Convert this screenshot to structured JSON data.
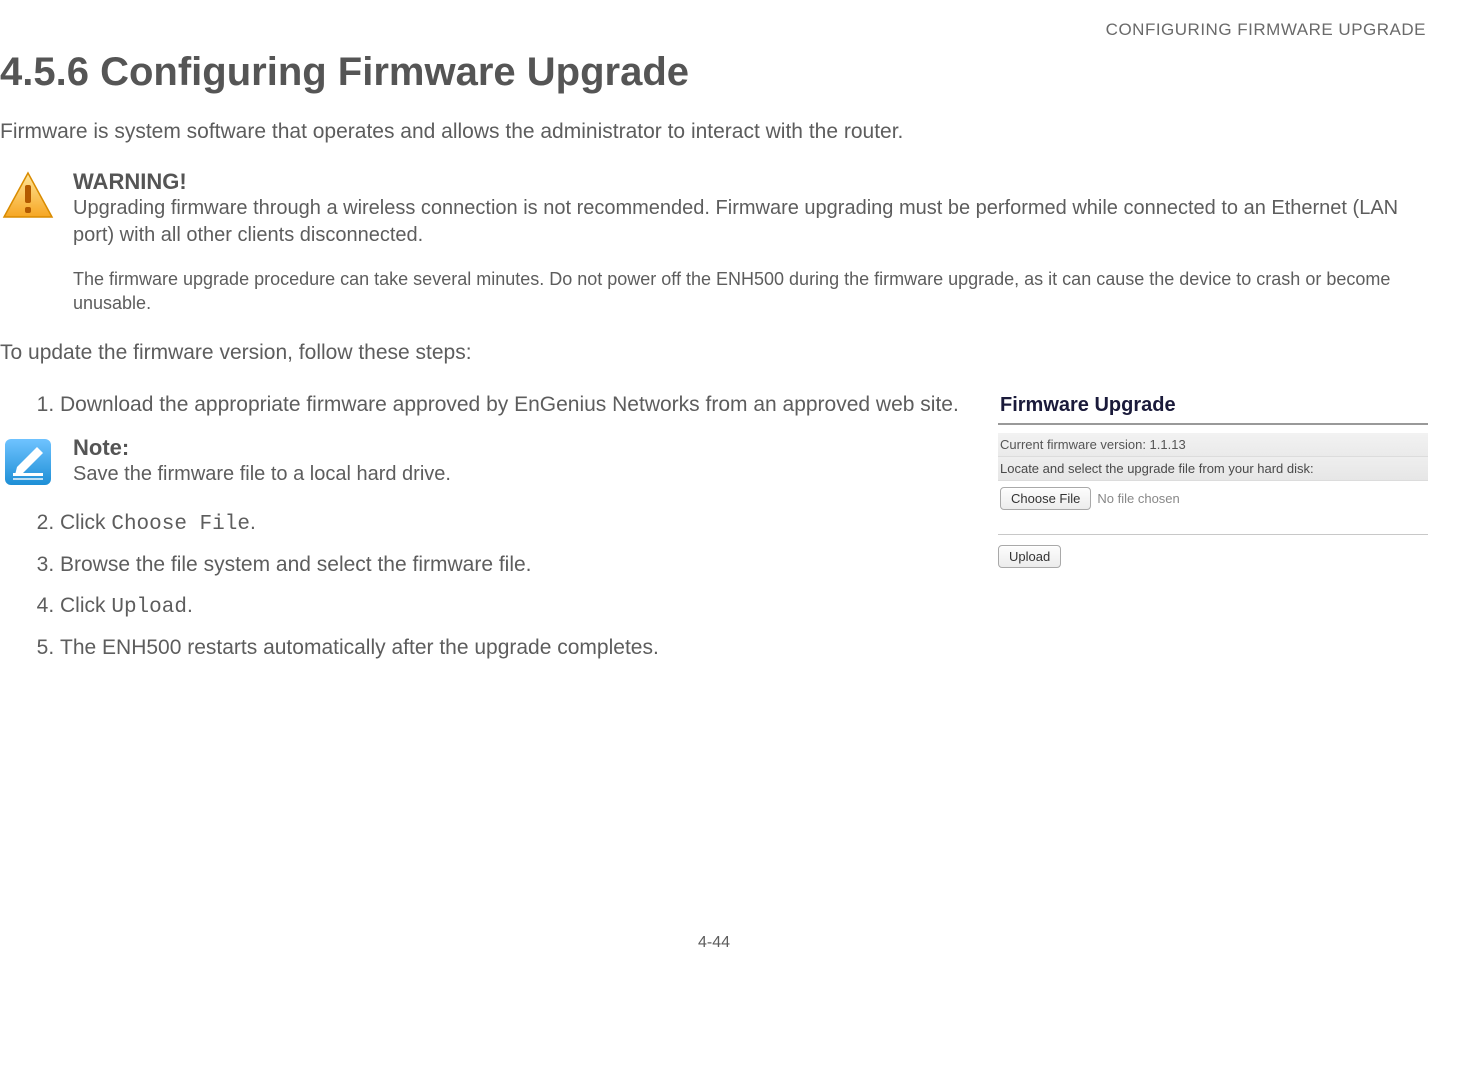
{
  "running_header": "CONFIGURING FIRMWARE UPGRADE",
  "heading": "4.5.6 Configuring Firmware Upgrade",
  "intro": "Firmware is system software that operates and allows the administrator to interact with the router.",
  "warning": {
    "title": "WARNING!",
    "text": "Upgrading firmware through a wireless connection is not recommended. Firmware upgrading must be performed while connected to an Ethernet (LAN port) with all other clients disconnected.",
    "subtext": "The firmware upgrade procedure can take several minutes. Do not power off the ENH500 during the firmware upgrade, as it can cause the device to crash or become unusable."
  },
  "steps_intro": "To update the firmware version, follow these steps:",
  "steps": {
    "s1": "Download the appropriate firmware approved by EnGenius Networks from an approved web site.",
    "s2_prefix": "Click ",
    "s2_code": "Choose File",
    "s2_suffix": ".",
    "s3": "Browse the file system and select the firmware file.",
    "s4_prefix": "Click ",
    "s4_code": "Upload",
    "s4_suffix": ".",
    "s5": "The ENH500 restarts automatically after the upgrade completes."
  },
  "note": {
    "title": "Note:",
    "text": "Save the firmware file to a local hard drive."
  },
  "widget": {
    "title": "Firmware Upgrade",
    "version_label": "Current firmware version: 1.1.13",
    "locate_label": "Locate and select the upgrade file from your hard disk:",
    "choose_file_label": "Choose File",
    "no_file_label": "No file chosen",
    "upload_label": "Upload"
  },
  "page_footer": "4-44"
}
